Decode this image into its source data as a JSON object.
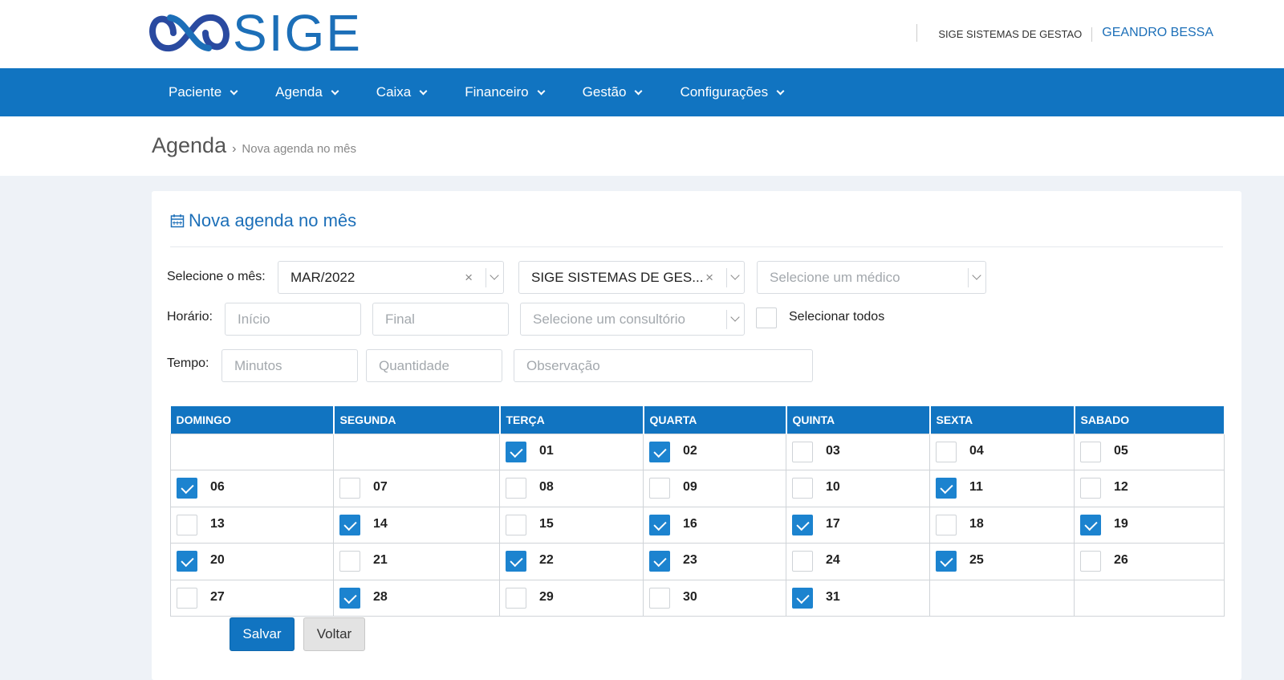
{
  "header": {
    "logo_text": "SIGE",
    "company": "SIGE SISTEMAS DE GESTAO",
    "user": "GEANDRO BESSA"
  },
  "nav": {
    "items": [
      {
        "label": "Paciente"
      },
      {
        "label": "Agenda"
      },
      {
        "label": "Caixa"
      },
      {
        "label": "Financeiro"
      },
      {
        "label": "Gestão"
      },
      {
        "label": "Configurações"
      }
    ]
  },
  "breadcrumb": {
    "main": "Agenda",
    "separator": "›",
    "sub": "Nova agenda no mês"
  },
  "panel": {
    "title": "Nova agenda no mês"
  },
  "form": {
    "month_label": "Selecione o mês:",
    "month_value": "MAR/2022",
    "company_value": "SIGE SISTEMAS DE GES...",
    "doctor_placeholder": "Selecione um médico",
    "time_label": "Horário:",
    "start_placeholder": "Início",
    "end_placeholder": "Final",
    "office_placeholder": "Selecione um consultório",
    "select_all_label": "Selecionar todos",
    "duration_label": "Tempo:",
    "minutes_placeholder": "Minutos",
    "quantity_placeholder": "Quantidade",
    "note_placeholder": "Observação",
    "clear_symbol": "×"
  },
  "calendar": {
    "headers": [
      "DOMINGO",
      "SEGUNDA",
      "TERÇA",
      "QUARTA",
      "QUINTA",
      "SEXTA",
      "SABADO"
    ],
    "weeks": [
      [
        null,
        null,
        {
          "day": "01",
          "checked": true
        },
        {
          "day": "02",
          "checked": true
        },
        {
          "day": "03",
          "checked": false
        },
        {
          "day": "04",
          "checked": false
        },
        {
          "day": "05",
          "checked": false
        }
      ],
      [
        {
          "day": "06",
          "checked": true
        },
        {
          "day": "07",
          "checked": false
        },
        {
          "day": "08",
          "checked": false
        },
        {
          "day": "09",
          "checked": false
        },
        {
          "day": "10",
          "checked": false
        },
        {
          "day": "11",
          "checked": true
        },
        {
          "day": "12",
          "checked": false
        }
      ],
      [
        {
          "day": "13",
          "checked": false
        },
        {
          "day": "14",
          "checked": true
        },
        {
          "day": "15",
          "checked": false
        },
        {
          "day": "16",
          "checked": true
        },
        {
          "day": "17",
          "checked": true
        },
        {
          "day": "18",
          "checked": false
        },
        {
          "day": "19",
          "checked": true
        }
      ],
      [
        {
          "day": "20",
          "checked": true
        },
        {
          "day": "21",
          "checked": false
        },
        {
          "day": "22",
          "checked": true
        },
        {
          "day": "23",
          "checked": true
        },
        {
          "day": "24",
          "checked": false
        },
        {
          "day": "25",
          "checked": true
        },
        {
          "day": "26",
          "checked": false
        }
      ],
      [
        {
          "day": "27",
          "checked": false
        },
        {
          "day": "28",
          "checked": true
        },
        {
          "day": "29",
          "checked": false
        },
        {
          "day": "30",
          "checked": false
        },
        {
          "day": "31",
          "checked": true
        },
        null,
        null
      ]
    ]
  },
  "actions": {
    "save_label": "Salvar",
    "back_label": "Voltar"
  },
  "colors": {
    "primary": "#1174c1",
    "checkbox": "#1c83cf",
    "background": "#eef2f7"
  }
}
